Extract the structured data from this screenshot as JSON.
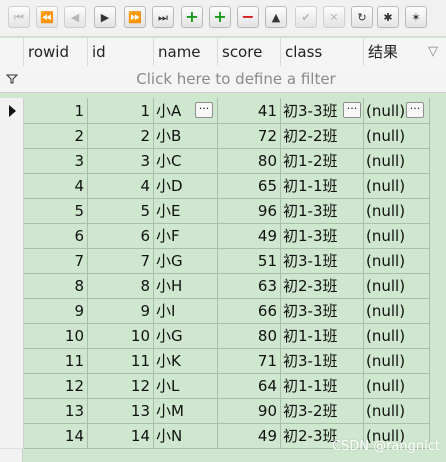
{
  "toolbar": {
    "buttons": [
      {
        "name": "first-record-button",
        "glyph": "⏮",
        "disabled": true
      },
      {
        "name": "prior-page-button",
        "glyph": "⏪",
        "disabled": true
      },
      {
        "name": "prior-record-button",
        "glyph": "◀",
        "disabled": true
      },
      {
        "name": "next-record-button",
        "glyph": "▶",
        "disabled": false
      },
      {
        "name": "next-page-button",
        "glyph": "⏩",
        "disabled": false
      },
      {
        "name": "last-record-button",
        "glyph": "⏭",
        "disabled": false
      },
      {
        "name": "insert-record-button",
        "glyph": "+",
        "disabled": false
      },
      {
        "name": "insert-multiple-button",
        "glyph": "+",
        "disabled": false
      },
      {
        "name": "delete-record-button",
        "glyph": "−",
        "disabled": false
      },
      {
        "name": "edit-record-button",
        "glyph": "▲",
        "disabled": false
      },
      {
        "name": "post-edit-button",
        "glyph": "✔",
        "disabled": true
      },
      {
        "name": "cancel-edit-button",
        "glyph": "✕",
        "disabled": true
      },
      {
        "name": "refresh-button",
        "glyph": "↻",
        "disabled": false
      },
      {
        "name": "save-bookmark-button",
        "glyph": "✱",
        "disabled": false
      },
      {
        "name": "filter-button",
        "glyph": "✶",
        "disabled": false
      }
    ],
    "colors": {
      "add": "#1a9a1a",
      "delete": "#d22020"
    }
  },
  "grid": {
    "columns": [
      "rowid",
      "id",
      "name",
      "score",
      "class",
      "结果"
    ],
    "filter_placeholder": "Click here to define a filter",
    "rows": [
      {
        "rowid": "1",
        "id": "1",
        "name": "小A",
        "score": "41",
        "class": "初3-3班",
        "result": "(null)"
      },
      {
        "rowid": "2",
        "id": "2",
        "name": "小B",
        "score": "72",
        "class": "初2-2班",
        "result": "(null)"
      },
      {
        "rowid": "3",
        "id": "3",
        "name": "小C",
        "score": "80",
        "class": "初1-2班",
        "result": "(null)"
      },
      {
        "rowid": "4",
        "id": "4",
        "name": "小D",
        "score": "65",
        "class": "初1-1班",
        "result": "(null)"
      },
      {
        "rowid": "5",
        "id": "5",
        "name": "小E",
        "score": "96",
        "class": "初1-3班",
        "result": "(null)"
      },
      {
        "rowid": "6",
        "id": "6",
        "name": "小F",
        "score": "49",
        "class": "初1-3班",
        "result": "(null)"
      },
      {
        "rowid": "7",
        "id": "7",
        "name": "小G",
        "score": "51",
        "class": "初3-1班",
        "result": "(null)"
      },
      {
        "rowid": "8",
        "id": "8",
        "name": "小H",
        "score": "63",
        "class": "初2-3班",
        "result": "(null)"
      },
      {
        "rowid": "9",
        "id": "9",
        "name": "小I",
        "score": "66",
        "class": "初3-3班",
        "result": "(null)"
      },
      {
        "rowid": "10",
        "id": "10",
        "name": "小G",
        "score": "80",
        "class": "初1-1班",
        "result": "(null)"
      },
      {
        "rowid": "11",
        "id": "11",
        "name": "小K",
        "score": "71",
        "class": "初3-1班",
        "result": "(null)"
      },
      {
        "rowid": "12",
        "id": "12",
        "name": "小L",
        "score": "64",
        "class": "初1-1班",
        "result": "(null)"
      },
      {
        "rowid": "13",
        "id": "13",
        "name": "小M",
        "score": "90",
        "class": "初3-2班",
        "result": "(null)"
      },
      {
        "rowid": "14",
        "id": "14",
        "name": "小N",
        "score": "49",
        "class": "初2-3班",
        "result": "(null)"
      }
    ],
    "ellipsis_label": "···"
  },
  "watermark": "CSDN @rangnict",
  "colors": {
    "row_bg": "#cfe7cf",
    "header_bg": "#f5f5f5",
    "filter_text": "#8a8a8a"
  }
}
